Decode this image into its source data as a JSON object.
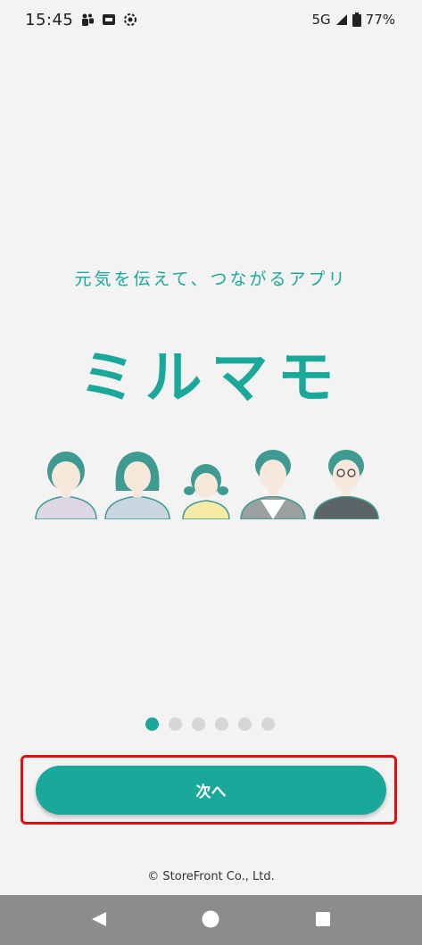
{
  "status_bar": {
    "time": "15:45",
    "network": "5G",
    "battery": "77%",
    "icons": [
      "teams-icon",
      "app-notification-icon",
      "screen-record-icon",
      "signal-icon",
      "battery-icon"
    ]
  },
  "splash": {
    "tagline": "元気を伝えて、つながるアプリ",
    "app_name": "ミルマモ"
  },
  "pagination": {
    "total": 6,
    "active": 1
  },
  "next_button": {
    "label": "次へ"
  },
  "footer": {
    "copyright": "© StoreFront Co., Ltd."
  },
  "navigation": {
    "icons": [
      "back-icon",
      "home-icon",
      "recents-icon"
    ]
  },
  "colors": {
    "accent": "#1aa89b",
    "highlight": "#e01010",
    "background": "#f3f3f3",
    "nav_bar": "#8c8c8c"
  }
}
